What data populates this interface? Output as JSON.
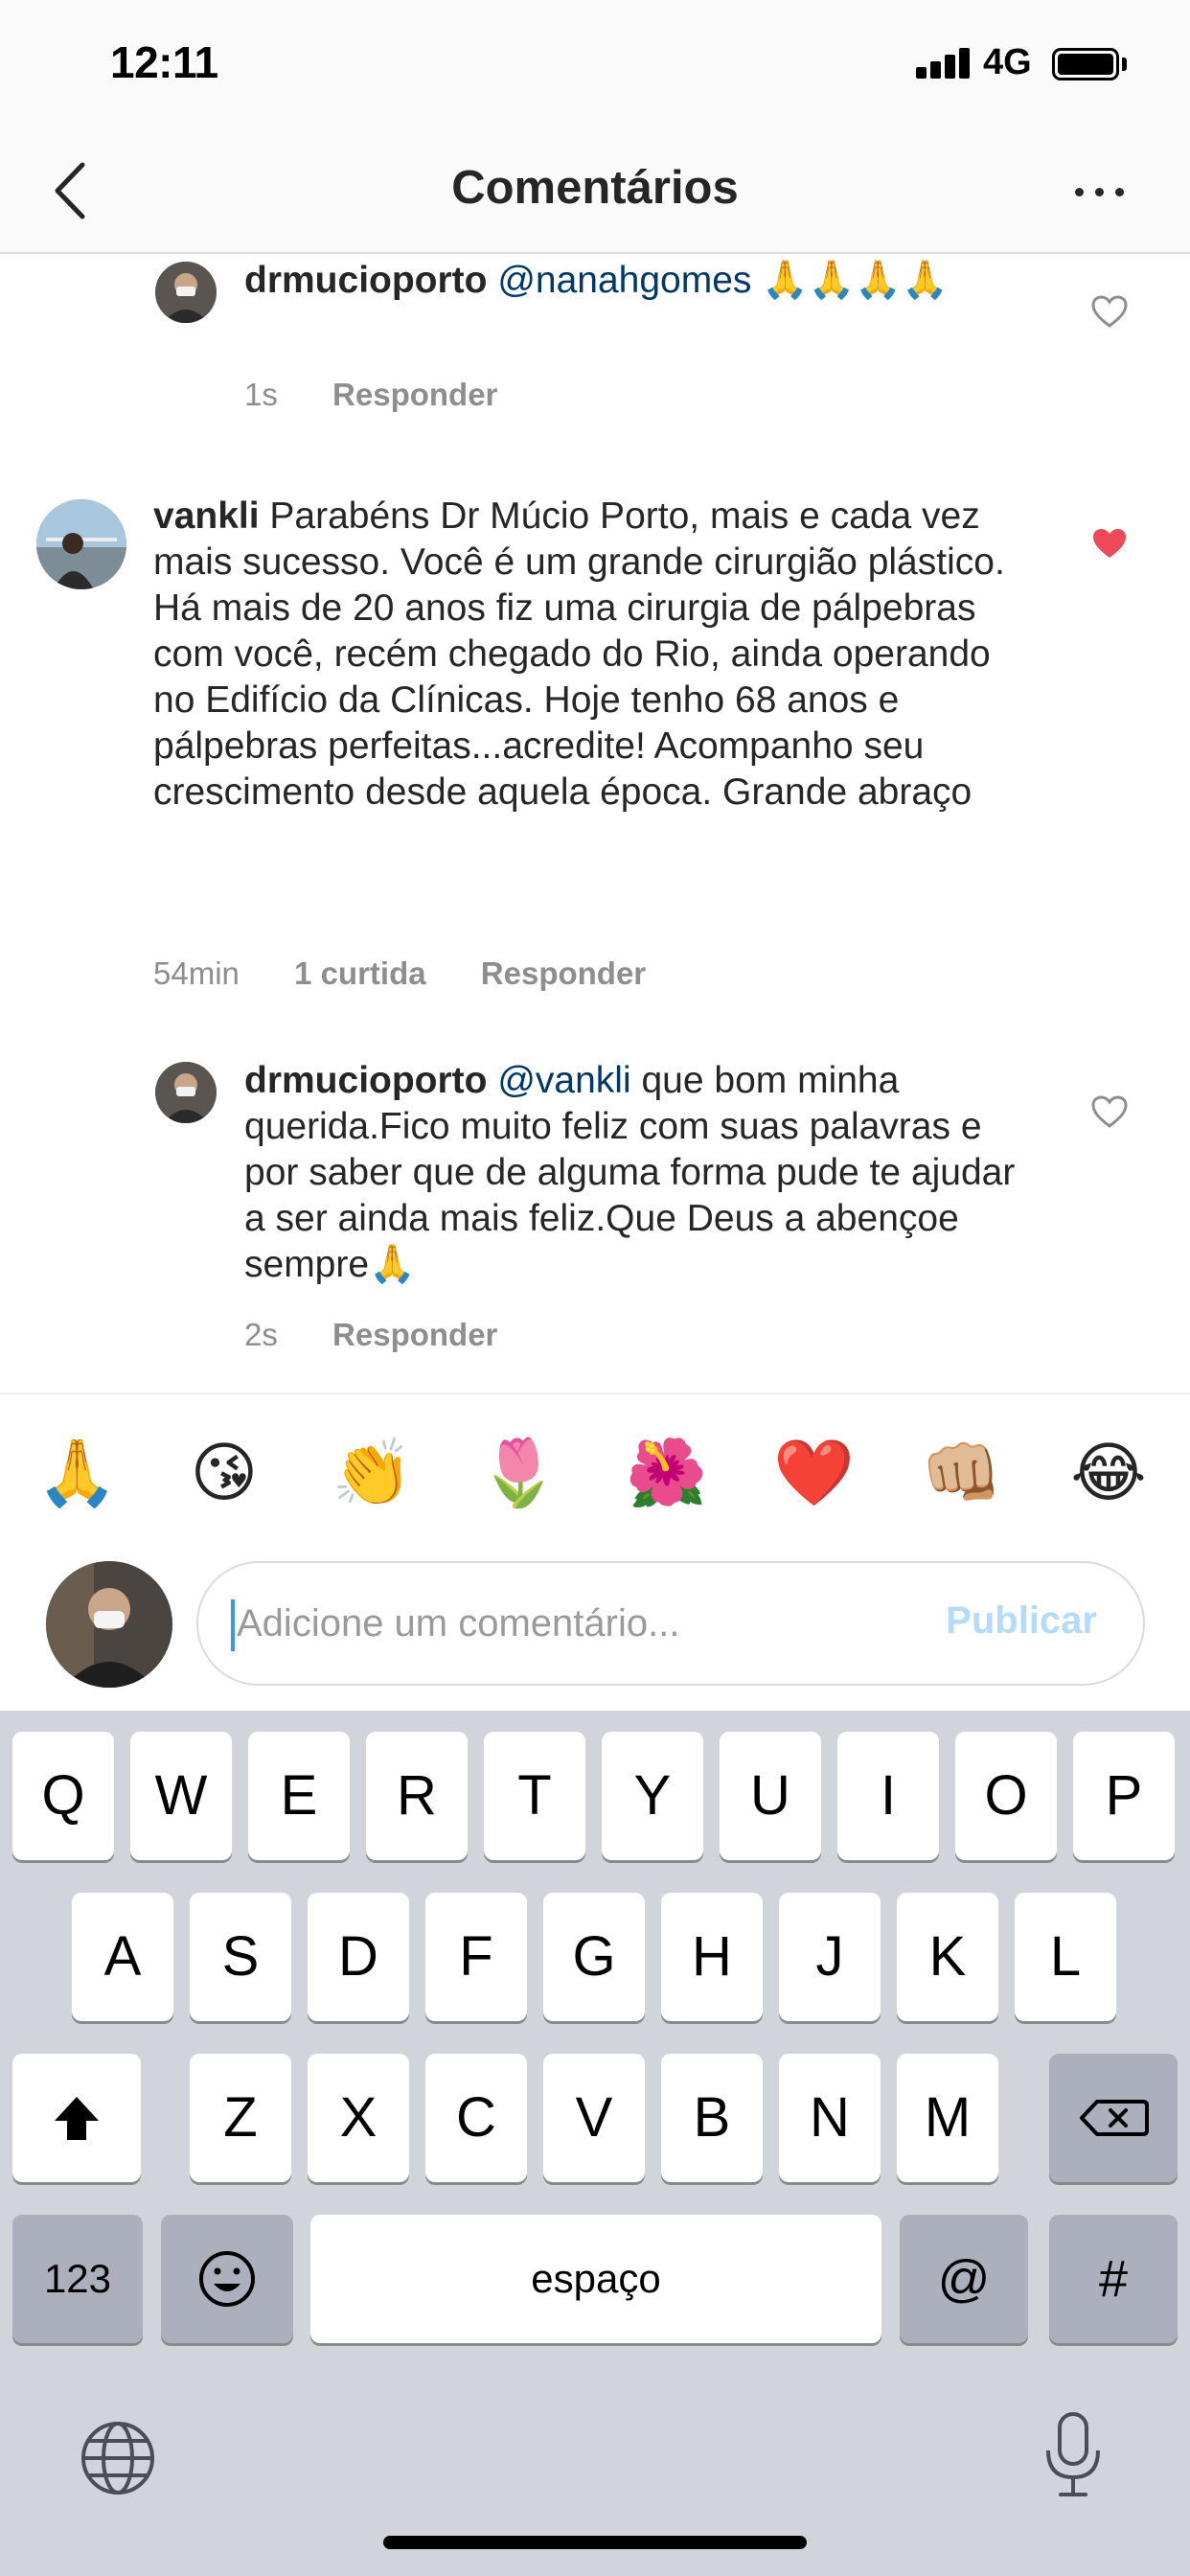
{
  "status_bar": {
    "time": "12:11",
    "network": "4G"
  },
  "header": {
    "title": "Comentários"
  },
  "comments": [
    {
      "username": "drmucioporto",
      "mention": "@nanahgomes",
      "text": " 🙏🙏🙏🙏",
      "time": "1s",
      "reply_label": "Responder",
      "liked": false
    },
    {
      "username": "vankli",
      "text": " Parabéns Dr Múcio Porto, mais e cada vez mais sucesso. Você é um grande cirurgião plástico. Há mais de 20 anos fiz uma cirurgia de pálpebras com você, recém chegado do Rio, ainda operando no Edifício da Clínicas. Hoje tenho 68 anos e pálpebras perfeitas...acredite! Acompanho seu crescimento desde aquela época. Grande abraço",
      "time": "54min",
      "likes_label": "1 curtida",
      "reply_label": "Responder",
      "liked": true
    },
    {
      "username": "drmucioporto",
      "mention": "@vankli",
      "text": " que bom minha querida.Fico muito feliz com suas palavras e por saber que de alguma forma pude te ajudar a ser ainda mais feliz.Que Deus a abençoe sempre🙏",
      "time": "2s",
      "reply_label": "Responder",
      "liked": false
    }
  ],
  "emoji_bar": [
    "🙏",
    "😘",
    "👏",
    "🌷",
    "🌺",
    "❤️",
    "👊🏼",
    "😂"
  ],
  "composer": {
    "placeholder": "Adicione um comentário...",
    "publish_label": "Publicar"
  },
  "keyboard": {
    "row1": [
      "Q",
      "W",
      "E",
      "R",
      "T",
      "Y",
      "U",
      "I",
      "O",
      "P"
    ],
    "row2": [
      "A",
      "S",
      "D",
      "F",
      "G",
      "H",
      "J",
      "K",
      "L"
    ],
    "row3": [
      "Z",
      "X",
      "C",
      "V",
      "B",
      "N",
      "M"
    ],
    "numbers_label": "123",
    "space_label": "espaço",
    "at_label": "@",
    "hash_label": "#"
  },
  "colors": {
    "heart_liked": "#ed4956",
    "mention": "#00376b",
    "publish": "#b3dbff",
    "caret": "#3797f0"
  }
}
